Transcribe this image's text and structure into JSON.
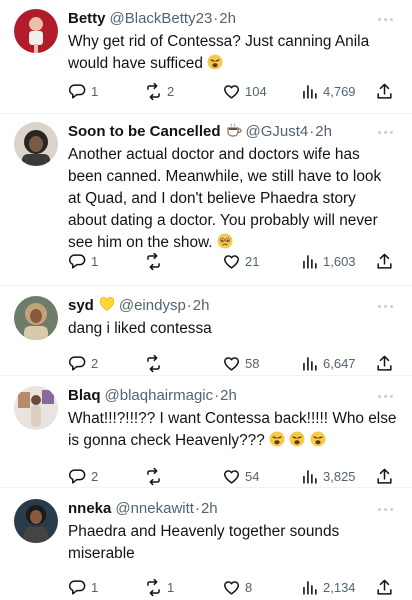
{
  "tweets": [
    {
      "name": "Betty",
      "badge": "",
      "handle": "@BlackBetty23",
      "time": "2h",
      "text": "Why get rid of Contessa? Just canning Anila would have sufficed",
      "emojis": [
        "weary"
      ],
      "replies": "1",
      "retweets": "2",
      "likes": "104",
      "views": "4,769"
    },
    {
      "name": "Soon to be Cancelled",
      "badge": "coffee",
      "handle": "@GJust4",
      "time": "2h",
      "text": "Another actual doctor and doctors wife has been canned. Meanwhile, we still have to look at Quad, and I don't believe Phaedra story about dating a doctor. You probably will never see him on the show.",
      "emojis": [
        "pleading"
      ],
      "replies": "1",
      "retweets": "",
      "likes": "21",
      "views": "1,603"
    },
    {
      "name": "syd",
      "badge": "yellow-heart",
      "handle": "@eindysp",
      "time": "2h",
      "text": "dang i liked contessa",
      "emojis": [],
      "replies": "2",
      "retweets": "",
      "likes": "58",
      "views": "6,647"
    },
    {
      "name": "Blaq",
      "badge": "",
      "handle": "@blaqhairmagic",
      "time": "2h",
      "text": "What!!!?!!!?? I want Contessa back!!!!! Who else is gonna check Heavenly???",
      "emojis": [
        "weary",
        "weary",
        "weary"
      ],
      "replies": "2",
      "retweets": "",
      "likes": "54",
      "views": "3,825"
    },
    {
      "name": "nneka",
      "badge": "",
      "handle": "@nnekawitt",
      "time": "2h",
      "text": "Phaedra and Heavenly together sounds miserable",
      "emojis": [],
      "replies": "1",
      "retweets": "1",
      "likes": "8",
      "views": "2,134"
    }
  ],
  "icons": {
    "reply": "reply-icon",
    "retweet": "retweet-icon",
    "like": "heart-icon",
    "views": "views-icon",
    "share": "share-icon",
    "more": "more-icon"
  },
  "colors": {
    "text": "#0f1419",
    "muted": "#536471",
    "divider": "#eff3f4",
    "weary_emoji": "#f7c948",
    "yellow_heart": "#fdd835"
  }
}
